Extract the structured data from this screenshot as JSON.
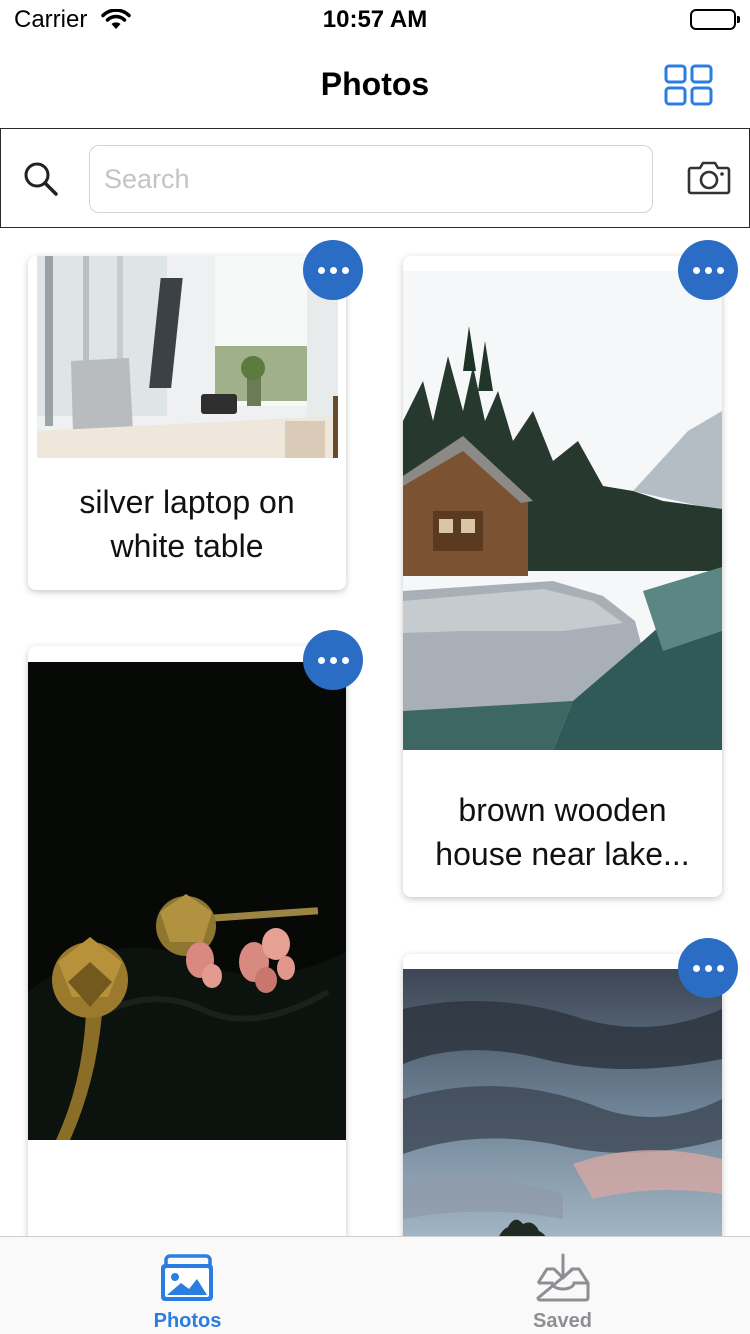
{
  "status_bar": {
    "carrier": "Carrier",
    "time": "10:57 AM"
  },
  "nav": {
    "title": "Photos",
    "layout_icon": "grid-icon"
  },
  "search": {
    "placeholder": "Search",
    "value": "",
    "search_icon": "search-icon",
    "camera_icon": "camera-icon"
  },
  "cards": [
    {
      "caption": "silver laptop on\nwhite table",
      "image": "laptop-desk-photo"
    },
    {
      "caption": "brown wooden\nhouse near lake...",
      "image": "lake-cabin-photo"
    },
    {
      "caption": "",
      "image": "artichoke-flowers-photo"
    },
    {
      "caption": "",
      "image": "cloudy-sky-photo"
    }
  ],
  "tabs": [
    {
      "label": "Photos",
      "icon": "photos-icon",
      "active": true
    },
    {
      "label": "Saved",
      "icon": "saved-tray-icon",
      "active": false
    }
  ],
  "colors": {
    "accent": "#2b6cc4",
    "tab_active": "#2a7de1",
    "tab_inactive": "#8e8e93"
  }
}
